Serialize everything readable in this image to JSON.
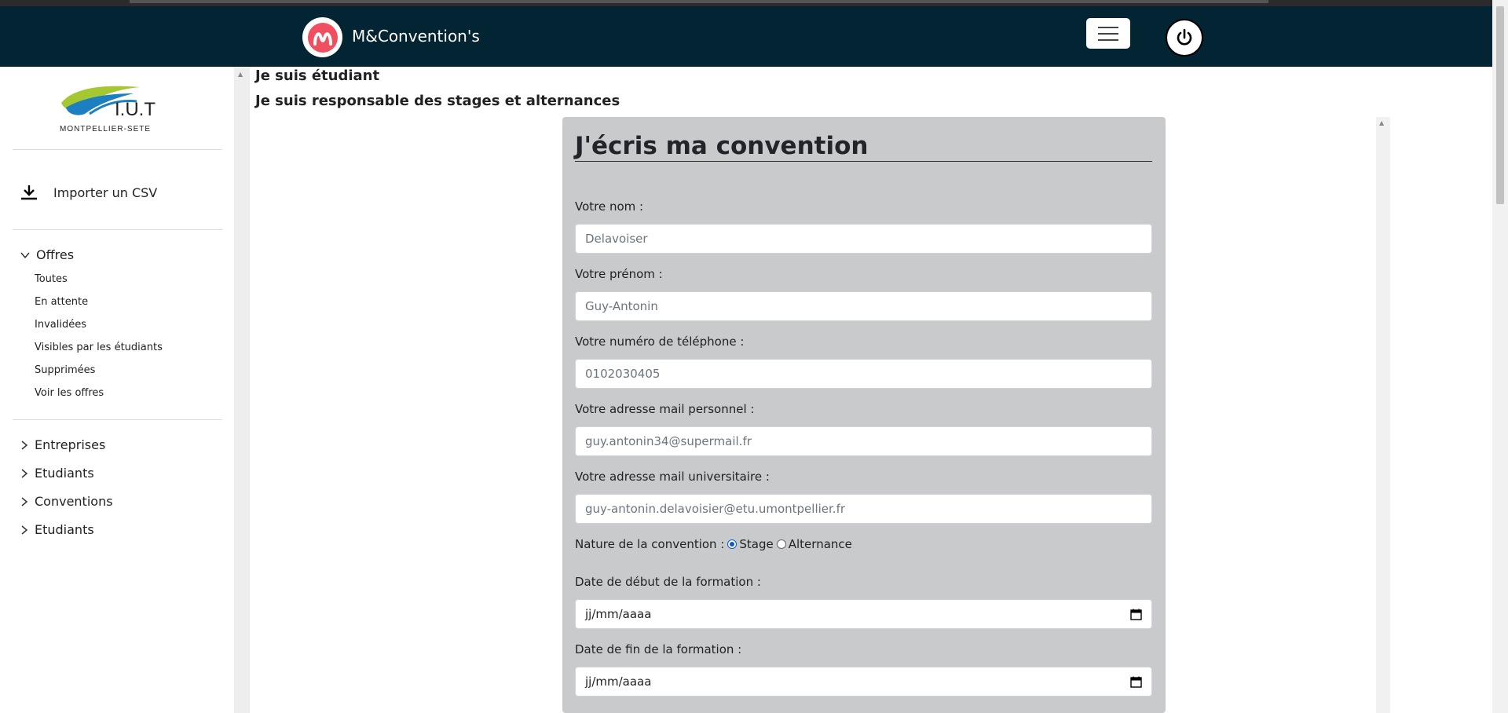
{
  "app": {
    "brand_name": "M&Convention's",
    "brand_letter": "M"
  },
  "header": {
    "menu_toggle": "menu",
    "power": "power"
  },
  "sidebar": {
    "logo": {
      "text": "I.U.T",
      "subtitle": "MONTPELLIER-SETE"
    },
    "import_label": "Importer un CSV",
    "offres": {
      "title": "Offres",
      "items": [
        "Toutes",
        "En attente",
        "Invalidées",
        "Visibles par les étudiants",
        "Supprimées",
        "Voir les offres"
      ]
    },
    "groups": [
      "Entreprises",
      "Etudiants",
      "Conventions",
      "Etudiants"
    ]
  },
  "roles": {
    "student": "Je suis étudiant",
    "manager": "Je suis responsable des stages et alternances"
  },
  "form": {
    "title": "J'écris ma convention",
    "nom_label": "Votre nom :",
    "nom_placeholder": "Delavoiser",
    "prenom_label": "Votre prénom :",
    "prenom_placeholder": "Guy-Antonin",
    "tel_label": "Votre numéro de téléphone :",
    "tel_placeholder": "0102030405",
    "mail_perso_label": "Votre adresse mail personnel :",
    "mail_perso_placeholder": "guy.antonin34@supermail.fr",
    "mail_univ_label": "Votre adresse mail universitaire :",
    "mail_univ_placeholder": "guy-antonin.delavoisier@etu.umontpellier.fr",
    "nature_label": "Nature de la convention :",
    "nature_options": [
      "Stage",
      "Alternance"
    ],
    "nature_selected": "Stage",
    "date_debut_label": "Date de début de la formation :",
    "date_debut_value": "jj/mm/aaaa",
    "date_fin_label": "Date de fin de la formation :",
    "date_fin_value": "jj/mm/aaaa"
  },
  "colors": {
    "topbar": "#032433",
    "brand_accent": "#ef4f5f",
    "card": "#c9cacc"
  }
}
